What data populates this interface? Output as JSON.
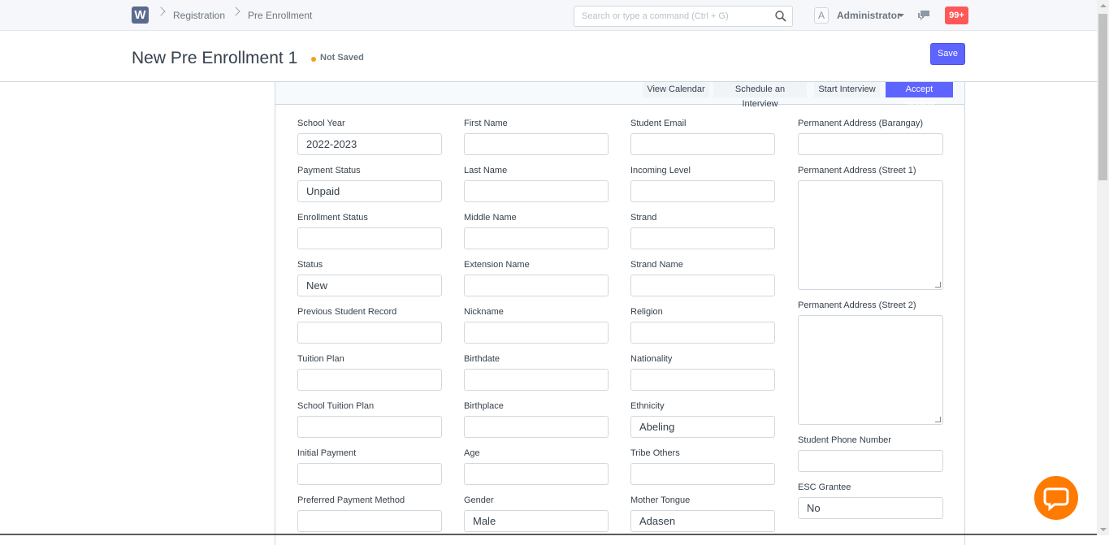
{
  "navbar": {
    "logo_letter": "W",
    "breadcrumbs": [
      "Registration",
      "Pre Enrollment"
    ],
    "search_placeholder": "Search or type a command (Ctrl + G)",
    "avatar_letter": "A",
    "user": "Administrator",
    "notification_count": "99+"
  },
  "page": {
    "title": "New Pre Enrollment 1",
    "status": "Not Saved",
    "save_label": "Save"
  },
  "toolbar": {
    "buttons": [
      "View Calendar",
      "Schedule an Interview",
      "Start Interview",
      "Accept Student"
    ]
  },
  "form": {
    "col1": [
      {
        "label": "School Year",
        "value": "2022-2023"
      },
      {
        "label": "Payment Status",
        "value": "Unpaid"
      },
      {
        "label": "Enrollment Status",
        "value": ""
      },
      {
        "label": "Status",
        "value": "New"
      },
      {
        "label": "Previous Student Record",
        "value": ""
      },
      {
        "label": "Tuition Plan",
        "value": ""
      },
      {
        "label": "School Tuition Plan",
        "value": ""
      },
      {
        "label": "Initial Payment",
        "value": ""
      },
      {
        "label": "Preferred Payment Method",
        "value": ""
      }
    ],
    "col2": [
      {
        "label": "First Name",
        "value": ""
      },
      {
        "label": "Last Name",
        "value": ""
      },
      {
        "label": "Middle Name",
        "value": ""
      },
      {
        "label": "Extension Name",
        "value": ""
      },
      {
        "label": "Nickname",
        "value": ""
      },
      {
        "label": "Birthdate",
        "value": ""
      },
      {
        "label": "Birthplace",
        "value": ""
      },
      {
        "label": "Age",
        "value": ""
      },
      {
        "label": "Gender",
        "value": "Male"
      }
    ],
    "col3": [
      {
        "label": "Student Email",
        "value": ""
      },
      {
        "label": "Incoming Level",
        "value": ""
      },
      {
        "label": "Strand",
        "value": ""
      },
      {
        "label": "Strand Name",
        "value": ""
      },
      {
        "label": "Religion",
        "value": ""
      },
      {
        "label": "Nationality",
        "value": ""
      },
      {
        "label": "Ethnicity",
        "value": "Abeling"
      },
      {
        "label": "Tribe Others",
        "value": ""
      },
      {
        "label": "Mother Tongue",
        "value": "Adasen"
      }
    ],
    "col4": {
      "barangay": {
        "label": "Permanent Address (Barangay)",
        "value": ""
      },
      "street1": {
        "label": "Permanent Address (Street 1)"
      },
      "street2": {
        "label": "Permanent Address (Street 2)"
      },
      "phone": {
        "label": "Student Phone Number",
        "value": ""
      },
      "esc": {
        "label": "ESC Grantee",
        "value": "No"
      }
    }
  },
  "colors": {
    "primary": "#5e64ff",
    "notification": "#ff5858",
    "chat_bubble": "#ff7a00",
    "unsaved_dot": "#f0a01d"
  }
}
